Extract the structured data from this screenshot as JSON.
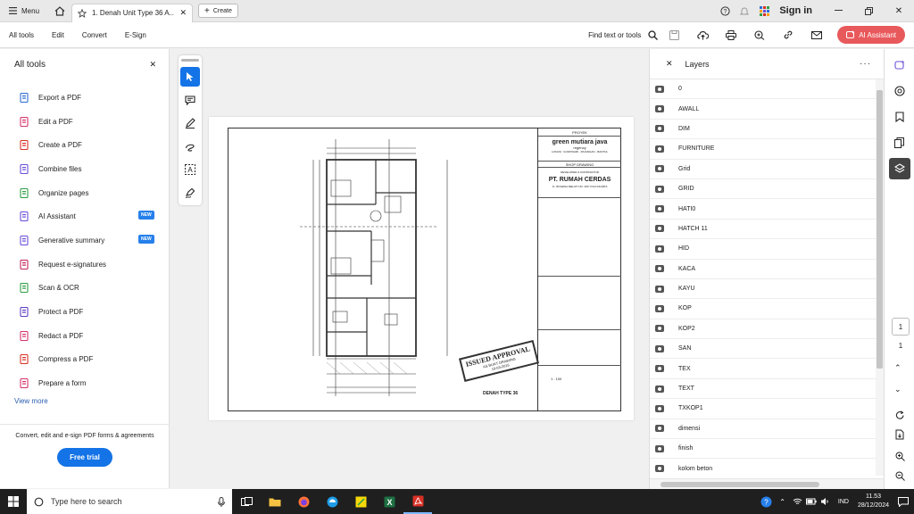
{
  "titlebar": {
    "menu_label": "Menu",
    "tab_title": "1. Denah Unit Type 36 A...",
    "create_label": "Create",
    "signin_label": "Sign in"
  },
  "menubar": {
    "items": [
      "All tools",
      "Edit",
      "Convert",
      "E-Sign"
    ],
    "find_label": "Find text or tools",
    "ai_label": "AI Assistant"
  },
  "leftpanel": {
    "title": "All tools",
    "items": [
      {
        "label": "Export a PDF",
        "icon": "export-pdf-icon",
        "color": "#2e6cd4"
      },
      {
        "label": "Edit a PDF",
        "icon": "edit-pdf-icon",
        "color": "#d6336c"
      },
      {
        "label": "Create a PDF",
        "icon": "create-pdf-icon",
        "color": "#d93025"
      },
      {
        "label": "Combine files",
        "icon": "combine-files-icon",
        "color": "#6b4fd8"
      },
      {
        "label": "Organize pages",
        "icon": "organize-pages-icon",
        "color": "#2f9e44"
      },
      {
        "label": "AI Assistant",
        "icon": "ai-assistant-icon",
        "color": "#6b4fd8",
        "badge": "NEW"
      },
      {
        "label": "Generative summary",
        "icon": "generative-summary-icon",
        "color": "#6b4fd8",
        "badge": "NEW"
      },
      {
        "label": "Request e-signatures",
        "icon": "request-signatures-icon",
        "color": "#c2255c"
      },
      {
        "label": "Scan & OCR",
        "icon": "scan-ocr-icon",
        "color": "#2f9e44"
      },
      {
        "label": "Protect a PDF",
        "icon": "protect-pdf-icon",
        "color": "#5f3dc4"
      },
      {
        "label": "Redact a PDF",
        "icon": "redact-pdf-icon",
        "color": "#d6336c"
      },
      {
        "label": "Compress a PDF",
        "icon": "compress-pdf-icon",
        "color": "#d93025"
      },
      {
        "label": "Prepare a form",
        "icon": "prepare-form-icon",
        "color": "#d6336c"
      }
    ],
    "view_more": "View more",
    "footer_text": "Convert, edit and e-sign PDF forms & agreements",
    "free_trial": "Free trial"
  },
  "document": {
    "proyek_label": "PROYEK",
    "project_name": "green mutiara java",
    "project_sub": "regency",
    "lokasi": "LOKASI : GUWOSARI - PAJANGAN - BANTUL",
    "shop_drawing": "SHOP DRAWING",
    "developer_label": "DEVELOPER & KONTRAKTOR",
    "company": "PT. RUMAH CERDAS",
    "address": "JL. BOGENA MELATI NO. 206 YOGYAKARTA",
    "stamp_line1": "ISSUED APPROVAL",
    "stamp_line2": "AS BUILT DRAWING",
    "stamp_date": "10-03-2016",
    "drawing_title": "DENAH TYPE 36",
    "scale": "1 : 100"
  },
  "layers": {
    "title": "Layers",
    "items": [
      "0",
      "AWALL",
      "DIM",
      "FURNITURE",
      "Grid",
      "GRID",
      "HATI0",
      "HATCH 11",
      "HID",
      "KACA",
      "KAYU",
      "KOP",
      "KOP2",
      "SAN",
      "TEX",
      "TEXT",
      "TXKOP1",
      "dimensi",
      "finish",
      "kolom beton"
    ]
  },
  "rightrail": {
    "page_current": "1",
    "page_total": "1"
  },
  "taskbar": {
    "search_placeholder": "Type here to search",
    "lang": "IND",
    "time": "11.53",
    "date": "28/12/2024"
  },
  "colors": {
    "accent": "#1473e6",
    "ai_button": "#e8595c"
  }
}
